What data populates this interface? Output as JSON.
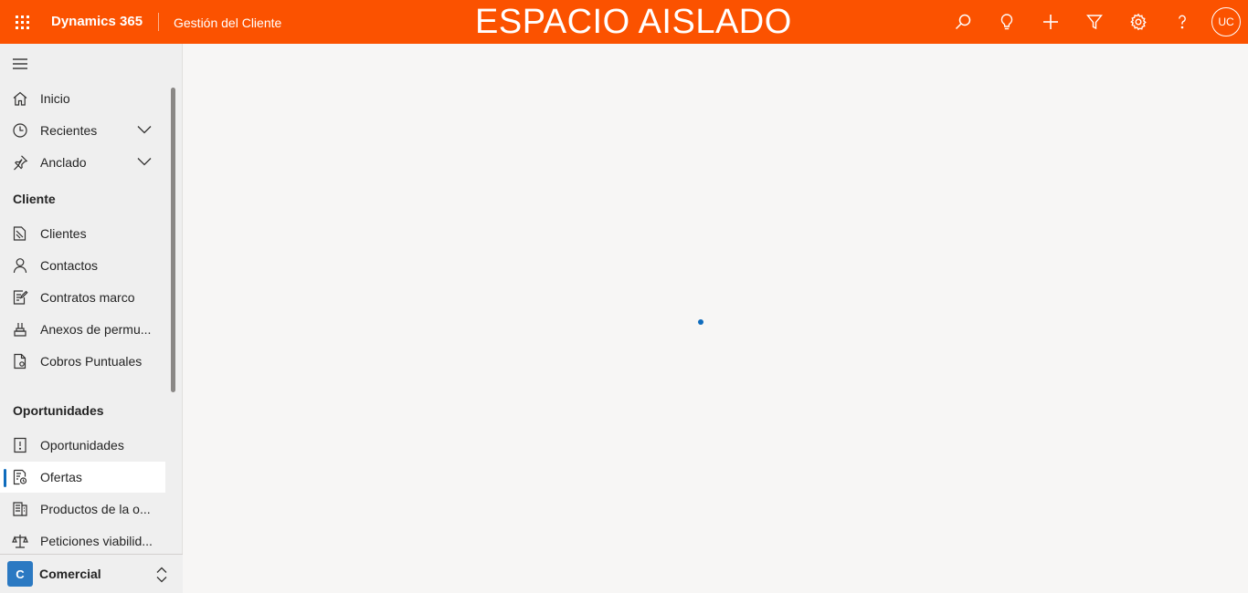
{
  "header": {
    "brand": "Dynamics 365",
    "app_name": "Gestión del Cliente",
    "environment_banner": "ESPACIO AISLADO",
    "avatar_initials": "UC",
    "bar_color": "#fb5200",
    "icons": [
      "search-icon",
      "lightbulb-icon",
      "add-icon",
      "filter-icon",
      "settings-icon",
      "help-icon"
    ]
  },
  "sidebar": {
    "top_items": [
      {
        "label": "Inicio",
        "icon": "home-icon"
      },
      {
        "label": "Recientes",
        "icon": "clock-icon",
        "expandable": true
      },
      {
        "label": "Anclado",
        "icon": "pin-icon",
        "expandable": true
      }
    ],
    "sections": [
      {
        "title": "Cliente",
        "items": [
          {
            "label": "Clientes",
            "icon": "accounts-icon"
          },
          {
            "label": "Contactos",
            "icon": "contact-icon"
          },
          {
            "label": "Contratos marco",
            "icon": "contract-icon"
          },
          {
            "label": "Anexos de permu...",
            "icon": "annex-icon"
          },
          {
            "label": "Cobros Puntuales",
            "icon": "document-icon"
          }
        ]
      },
      {
        "title": "Oportunidades",
        "items": [
          {
            "label": "Oportunidades",
            "icon": "opportunity-icon"
          },
          {
            "label": "Ofertas",
            "icon": "quote-icon",
            "selected": true
          },
          {
            "label": "Productos de la o...",
            "icon": "products-icon"
          },
          {
            "label": "Peticiones viabilid...",
            "icon": "scale-icon"
          }
        ]
      }
    ],
    "area": {
      "badge": "C",
      "name": "Comercial",
      "badge_color": "#2b79c2"
    }
  },
  "main": {
    "state": "loading",
    "accent": "#0f6cbd"
  }
}
